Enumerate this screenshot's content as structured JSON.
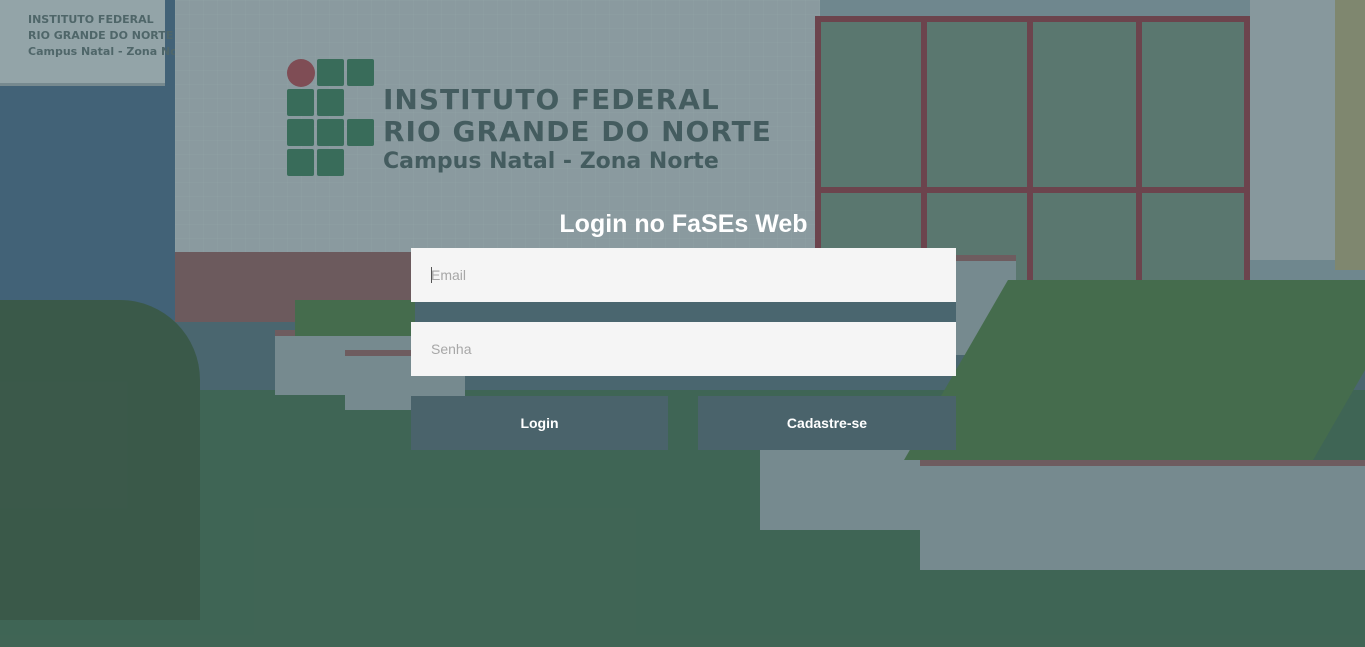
{
  "background": {
    "wall_sign": {
      "line1": "INSTITUTO FEDERAL",
      "line2": "RIO GRANDE DO NORTE",
      "line3": "Campus Natal - Zona Norte"
    },
    "small_sign": {
      "line1": "INSTITUTO FEDERAL",
      "line2": "RIO GRANDE DO NORTE",
      "line3": "Campus Natal - Zona Norte"
    }
  },
  "login": {
    "title": "Login no FaSEs Web",
    "email_placeholder": "Email",
    "email_value": "",
    "password_placeholder": "Senha",
    "password_value": "",
    "login_button": "Login",
    "signup_button": "Cadastre-se"
  },
  "colors": {
    "button_bg": "#4a636b",
    "input_bg": "#f5f5f5",
    "title_text": "#ffffff"
  }
}
